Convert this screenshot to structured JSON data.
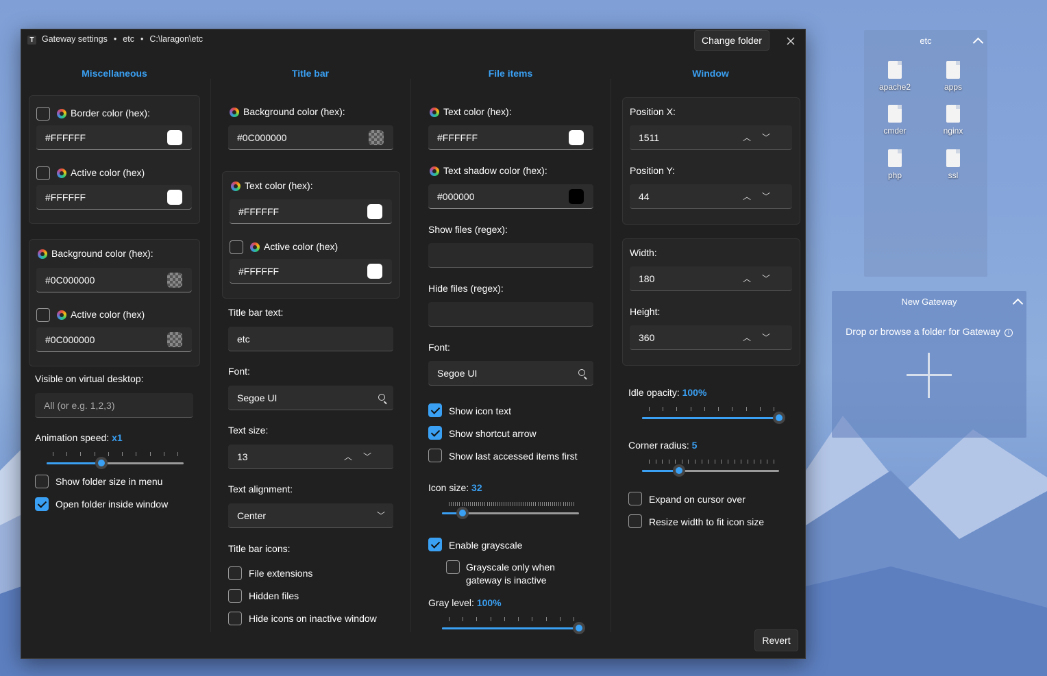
{
  "window": {
    "title": "Gateway settings",
    "title_sep": "•",
    "folder_name": "etc",
    "folder_path": "C:\\laragon\\etc",
    "change_folder_label": "Change folder",
    "revert_label": "Revert"
  },
  "misc": {
    "heading": "Miscellaneous",
    "border_color_label": "Border color (hex):",
    "border_color_value": "#FFFFFF",
    "border_active_label": "Active color (hex)",
    "border_active_value": "#FFFFFF",
    "bg_color_label": "Background color (hex):",
    "bg_color_value": "#0C000000",
    "bg_active_label": "Active color (hex)",
    "bg_active_value": "#0C000000",
    "virtual_desktop_label": "Visible on virtual desktop:",
    "virtual_desktop_placeholder": "All (or e.g. 1,2,3)",
    "animation_speed_label": "Animation speed:",
    "animation_speed_value": "x1",
    "animation_speed_fraction": 0.4,
    "show_folder_size_label": "Show folder size in menu",
    "show_folder_size_checked": false,
    "open_inside_label": "Open folder inside window",
    "open_inside_checked": true
  },
  "titlebar": {
    "heading": "Title bar",
    "bg_color_label": "Background color (hex):",
    "bg_color_value": "#0C000000",
    "text_color_label": "Text color (hex):",
    "text_color_value": "#FFFFFF",
    "active_color_label": "Active color (hex)",
    "active_color_value": "#FFFFFF",
    "text_label": "Title bar text:",
    "text_value": "etc",
    "font_label": "Font:",
    "font_value": "Segoe UI",
    "text_size_label": "Text size:",
    "text_size_value": "13",
    "alignment_label": "Text alignment:",
    "alignment_value": "Center",
    "icons_label": "Title bar icons:",
    "file_ext_label": "File extensions",
    "hidden_files_label": "Hidden files",
    "hide_icons_label": "Hide icons on inactive window"
  },
  "fileitems": {
    "heading": "File items",
    "text_color_label": "Text color (hex):",
    "text_color_value": "#FFFFFF",
    "shadow_color_label": "Text shadow color (hex):",
    "shadow_color_value": "#000000",
    "show_files_label": "Show files (regex):",
    "hide_files_label": "Hide files (regex):",
    "font_label": "Font:",
    "font_value": "Segoe UI",
    "show_icon_text_label": "Show icon text",
    "show_shortcut_label": "Show shortcut arrow",
    "show_last_label": "Show last accessed items first",
    "icon_size_label": "Icon size:",
    "icon_size_value": "32",
    "icon_size_fraction": 0.15,
    "grayscale_label": "Enable grayscale",
    "grayscale_inactive_label_1": "Grayscale only when",
    "grayscale_inactive_label_2": "gateway is inactive",
    "gray_level_label": "Gray level:",
    "gray_level_value": "100%",
    "gray_level_fraction": 1.0
  },
  "windowcol": {
    "heading": "Window",
    "pos_x_label": "Position X:",
    "pos_x_value": "1511",
    "pos_y_label": "Position Y:",
    "pos_y_value": "44",
    "width_label": "Width:",
    "width_value": "180",
    "height_label": "Height:",
    "height_value": "360",
    "idle_opacity_label": "Idle opacity:",
    "idle_opacity_value": "100%",
    "idle_opacity_fraction": 1.0,
    "corner_radius_label": "Corner radius:",
    "corner_radius_value": "5",
    "corner_radius_fraction": 0.27,
    "expand_label": "Expand on cursor over",
    "resize_label": "Resize width to fit icon size"
  },
  "etc_panel": {
    "title": "etc",
    "items": [
      "apache2",
      "apps",
      "cmder",
      "nginx",
      "php",
      "ssl"
    ]
  },
  "new_gateway": {
    "title": "New Gateway",
    "hint": "Drop or browse a folder for Gateway"
  },
  "colors": {
    "accent": "#3aa0f3",
    "window_bg": "#202020"
  }
}
